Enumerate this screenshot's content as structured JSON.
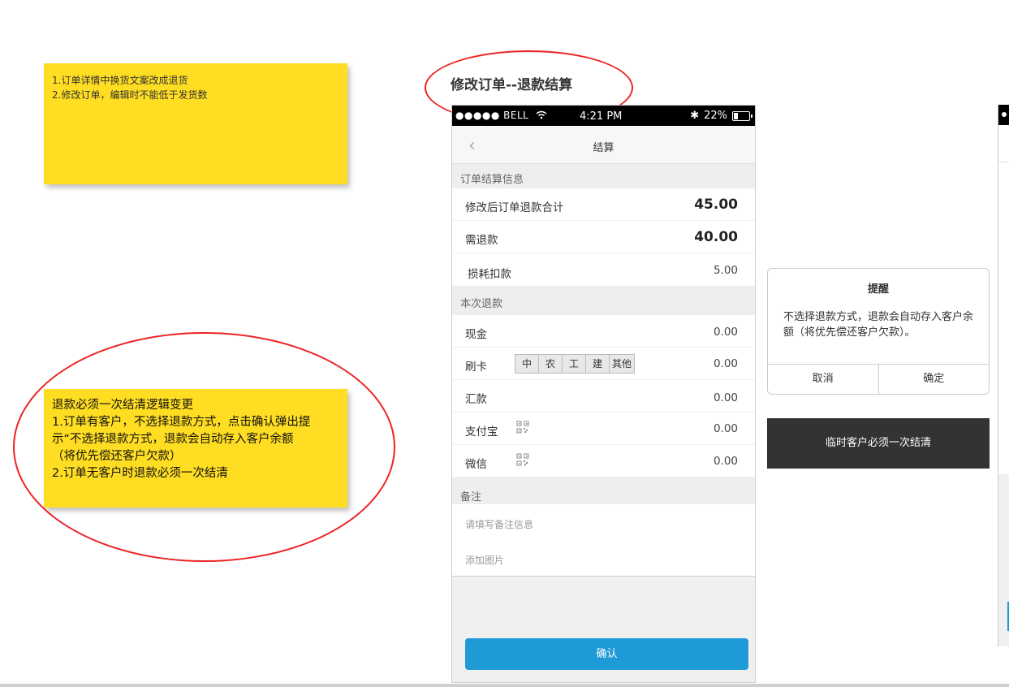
{
  "note1": {
    "lines": [
      "1.订单详情中换货文案改成退货",
      "2.修改订单，编辑时不能低于发货数"
    ]
  },
  "note2": {
    "lines": [
      "退款必须一次结清逻辑变更",
      "1.订单有客户，不选择退款方式，点击确认弹出提",
      "示“不选择退款方式，退款会自动存入客户余额",
      "（将优先偿还客户欠款）",
      "2.订单无客户时退款必须一次结清"
    ]
  },
  "page_title": "修改订单--退款结算",
  "phone": {
    "status": {
      "carrier": "●●●●● BELL",
      "time": "4:21 PM",
      "bluetooth": "✱",
      "battery": "22%"
    },
    "nav": {
      "back": "‹",
      "title": "结算"
    },
    "sections": {
      "summary": "订单结算信息",
      "refund": "本次退款",
      "memo": "备注"
    },
    "summary_rows": [
      {
        "label": "修改后订单退款合计",
        "value": "45.00"
      },
      {
        "label": "需退款",
        "value": "40.00"
      },
      {
        "label": "损耗扣款",
        "value": "5.00"
      }
    ],
    "refund_rows": [
      {
        "label": "现金",
        "value": "0.00"
      },
      {
        "label": "刷卡",
        "value": "0.00",
        "banks": [
          "中",
          "农",
          "工",
          "建",
          "其他"
        ]
      },
      {
        "label": "汇款",
        "value": "0.00"
      },
      {
        "label": "支付宝",
        "value": "0.00",
        "icon": "qr-code-icon"
      },
      {
        "label": "微信",
        "value": "0.00",
        "icon": "qr-code-icon"
      }
    ],
    "memo_placeholder": "请填写备注信息",
    "add_image": "添加图片",
    "confirm": "确认"
  },
  "dialog": {
    "title": "提醒",
    "message": "不选择退款方式，退款会自动存入客户余额（将优先偿还客户欠款）。",
    "cancel": "取消",
    "ok": "确定"
  },
  "toast": "临时客户必须一次结清",
  "colors": {
    "sticky": "#ffdd22",
    "annotation": "#ee2222",
    "primary": "#1e9ad6",
    "toast_bg": "#333333"
  }
}
